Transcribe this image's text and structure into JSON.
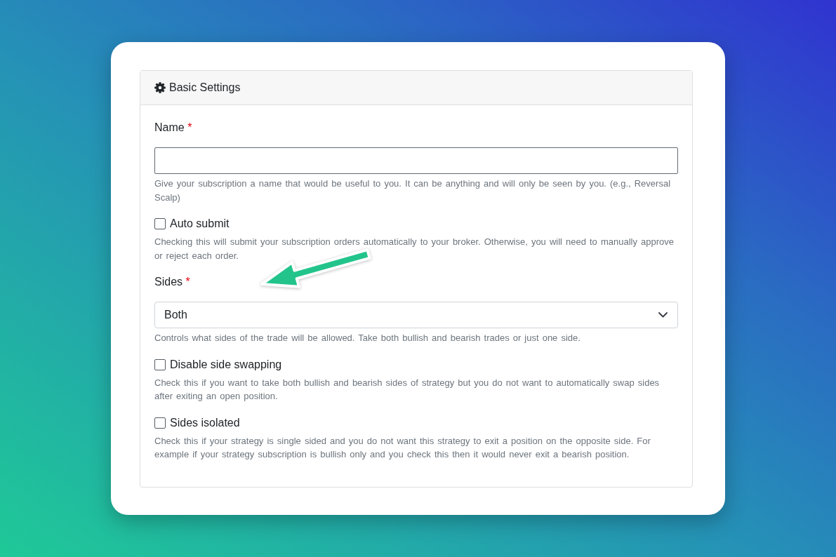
{
  "panel": {
    "title": "Basic Settings"
  },
  "fields": [
    {
      "kind": "text",
      "label": "Name",
      "required_mark": "*",
      "help": "Give your subscription a name that would be useful to you. It can be anything and will only be seen by you. (e.g., Reversal Scalp)"
    },
    {
      "kind": "checkbox",
      "label": "Auto submit",
      "checked": false,
      "help": "Checking this will submit your subscription orders automatically to your broker. Otherwise, you will need to manually approve or reject each order."
    },
    {
      "kind": "select",
      "label": "Sides",
      "required_mark": "*",
      "value": "Both",
      "help": "Controls what sides of the trade will be allowed. Take both bullish and bearish trades or just one side."
    },
    {
      "kind": "checkbox",
      "label": "Disable side swapping",
      "checked": false,
      "help": "Check this if you want to take both bullish and bearish sides of strategy but you do not want to automatically swap sides after exiting an open position."
    },
    {
      "kind": "checkbox",
      "label": "Sides isolated",
      "checked": false,
      "help": "Check this if your strategy is single sided and you do not want this strategy to exit a position on the opposite side. For example if your strategy subscription is bullish only and you check this then it would never exit a bearish position."
    }
  ]
}
